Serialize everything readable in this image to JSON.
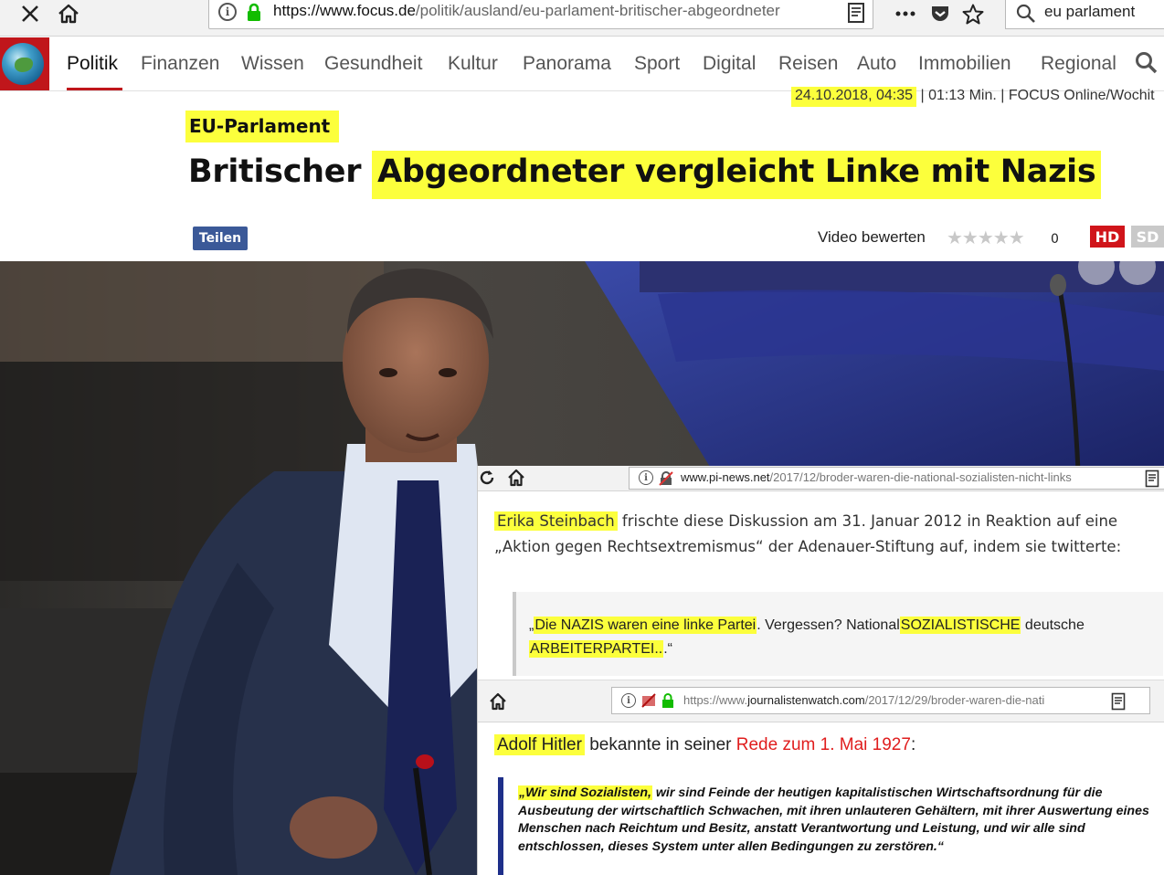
{
  "browser": {
    "url_domain": "https://www.focus.de",
    "url_path": "/politik/ausland/eu-parlament-britischer-abgeordneter",
    "search_query": "eu parlament",
    "icons": [
      "close-icon",
      "home-icon",
      "info-icon",
      "lock-icon",
      "reader-icon",
      "more-icon",
      "pocket-icon",
      "star-icon",
      "search-icon"
    ]
  },
  "nav": {
    "items": [
      "Politik",
      "Finanzen",
      "Wissen",
      "Gesundheit",
      "Kultur",
      "Panorama",
      "Sport",
      "Digital",
      "Reisen",
      "Auto",
      "Immobilien",
      "Regional"
    ],
    "active": "Politik",
    "accent": "#c0161b"
  },
  "article": {
    "date": "24.10.2018, 04:35",
    "separator": "|",
    "duration": "01:13 Min.",
    "source": "FOCUS Online/Wochit",
    "kicker": "EU-Parlament",
    "headline_plain": "Britischer",
    "headline_highlight": "Abgeordneter vergleicht Linke mit Nazis",
    "share_label": "Teilen",
    "rate_label": "Video bewerten",
    "stars": "★★★★★",
    "rating_count": "0",
    "rating": 0,
    "hd": "HD",
    "sd": "SD",
    "highlight_color": "#fcff3c"
  },
  "overlay1": {
    "url_domain": "www.pi-news.net",
    "url_path": "/2017/12/broder-waren-die-national-sozialisten-nicht-links",
    "name": "Erika Steinbach",
    "text": " frischte diese Diskussion am 31. Januar 2012 in Reaktion auf eine „Aktion gegen Rechtsextremismus“ der Adenauer-Stiftung auf, indem sie twitterte:",
    "quote_open": "„",
    "quote_hl1": "Die NAZIS waren eine linke Partei",
    "quote_mid": ". Vergessen? National",
    "quote_hl2": "SOZIALISTISCHE",
    "quote_mid2": " deutsche ",
    "quote_hl3": "ARBEITERPARTEI..",
    "quote_close": ".“"
  },
  "overlay2": {
    "url_prefix": "https://www.",
    "url_domain": "journalistenwatch.com",
    "url_path": "/2017/12/29/broder-waren-die-nati",
    "name": "Adolf Hitler",
    "text": " bekannte in seiner ",
    "red_text": "Rede zum 1. Mai 1927",
    "colon": ":",
    "quote_hl": "„Wir sind Sozialisten,",
    "quote_text": " wir sind Feinde der heutigen kapitalistischen Wirtschaftsordnung für die Ausbeutung der wirtschaftlich Schwachen, mit ihren unlauteren Gehältern, mit ihrer Auswertung eines Menschen nach Reichtum und Besitz, anstatt Verantwortung und Leistung, und wir alle sind entschlossen, dieses System unter allen Bedingungen zu zerstören.“"
  }
}
